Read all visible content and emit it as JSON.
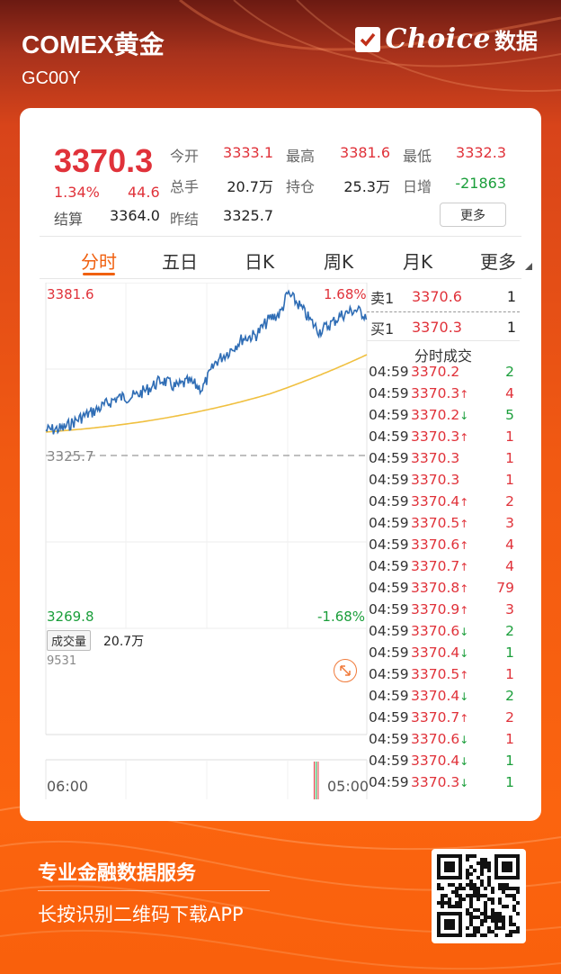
{
  "header": {
    "title": "COMEX黄金",
    "code": "GC00Y",
    "brand": "Choice",
    "brand_sub": "数据"
  },
  "quote": {
    "price": "3370.3",
    "change_pct": "1.34%",
    "change": "44.6",
    "settle_label": "结算",
    "settle": "3364.0",
    "items": [
      {
        "label": "今开",
        "value": "3333.1",
        "color": "red"
      },
      {
        "label": "最高",
        "value": "3381.6",
        "color": "red"
      },
      {
        "label": "最低",
        "value": "3332.3",
        "color": "red"
      },
      {
        "label": "总手",
        "value": "20.7万",
        "color": "dark"
      },
      {
        "label": "持仓",
        "value": "25.3万",
        "color": "dark"
      },
      {
        "label": "日增",
        "value": "-21863",
        "color": "green"
      },
      {
        "label": "昨结",
        "value": "3325.7",
        "color": "dark"
      }
    ],
    "more_label": "更多"
  },
  "tabs": [
    "分时",
    "五日",
    "日K",
    "周K",
    "月K",
    "更多"
  ],
  "chart": {
    "high_label": "3381.6",
    "high_pct": "1.68%",
    "prev_label": "3325.7",
    "low_label": "3269.8",
    "low_pct": "-1.68%",
    "volume_tag": "成交量",
    "volume_value": "20.7万",
    "volume_max": "9531",
    "time_start": "06:00",
    "time_end": "05:00",
    "colors": {
      "up": "#e0323a",
      "down": "#1a9e3a",
      "price_line": "#2f6db5",
      "avg_line": "#f0c040"
    }
  },
  "orderbook": {
    "ask": {
      "label": "卖1",
      "price": "3370.6",
      "vol": "1"
    },
    "bid": {
      "label": "买1",
      "price": "3370.3",
      "vol": "1"
    }
  },
  "ticks_title": "分时成交",
  "ticks": [
    {
      "time": "04:59",
      "price": "3370.2",
      "arrow": "",
      "vol": "2",
      "vol_color": "green"
    },
    {
      "time": "04:59",
      "price": "3370.3",
      "arrow": "↑",
      "vol": "4",
      "vol_color": "red"
    },
    {
      "time": "04:59",
      "price": "3370.2",
      "arrow": "↓",
      "vol": "5",
      "vol_color": "green"
    },
    {
      "time": "04:59",
      "price": "3370.3",
      "arrow": "↑",
      "vol": "1",
      "vol_color": "red"
    },
    {
      "time": "04:59",
      "price": "3370.3",
      "arrow": "",
      "vol": "1",
      "vol_color": "red"
    },
    {
      "time": "04:59",
      "price": "3370.3",
      "arrow": "",
      "vol": "1",
      "vol_color": "red"
    },
    {
      "time": "04:59",
      "price": "3370.4",
      "arrow": "↑",
      "vol": "2",
      "vol_color": "red"
    },
    {
      "time": "04:59",
      "price": "3370.5",
      "arrow": "↑",
      "vol": "3",
      "vol_color": "red"
    },
    {
      "time": "04:59",
      "price": "3370.6",
      "arrow": "↑",
      "vol": "4",
      "vol_color": "red"
    },
    {
      "time": "04:59",
      "price": "3370.7",
      "arrow": "↑",
      "vol": "4",
      "vol_color": "red"
    },
    {
      "time": "04:59",
      "price": "3370.8",
      "arrow": "↑",
      "vol": "79",
      "vol_color": "red"
    },
    {
      "time": "04:59",
      "price": "3370.9",
      "arrow": "↑",
      "vol": "3",
      "vol_color": "red"
    },
    {
      "time": "04:59",
      "price": "3370.6",
      "arrow": "↓",
      "vol": "2",
      "vol_color": "green"
    },
    {
      "time": "04:59",
      "price": "3370.4",
      "arrow": "↓",
      "vol": "1",
      "vol_color": "green"
    },
    {
      "time": "04:59",
      "price": "3370.5",
      "arrow": "↑",
      "vol": "1",
      "vol_color": "red"
    },
    {
      "time": "04:59",
      "price": "3370.4",
      "arrow": "↓",
      "vol": "2",
      "vol_color": "green"
    },
    {
      "time": "04:59",
      "price": "3370.7",
      "arrow": "↑",
      "vol": "2",
      "vol_color": "red"
    },
    {
      "time": "04:59",
      "price": "3370.6",
      "arrow": "↓",
      "vol": "1",
      "vol_color": "red"
    },
    {
      "time": "04:59",
      "price": "3370.4",
      "arrow": "↓",
      "vol": "1",
      "vol_color": "green"
    },
    {
      "time": "04:59",
      "price": "3370.3",
      "arrow": "↓",
      "vol": "1",
      "vol_color": "green"
    }
  ],
  "footer": {
    "line1": "专业金融数据服务",
    "line2": "长按识别二维码下载APP"
  }
}
